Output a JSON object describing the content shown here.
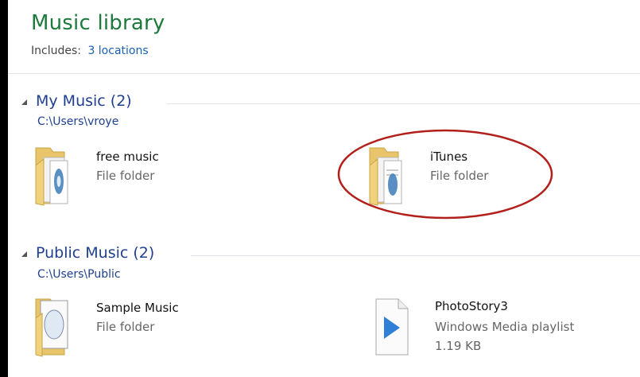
{
  "library": {
    "title": "Music library",
    "includes_label": "Includes:",
    "includes_link": "3 locations"
  },
  "groups": [
    {
      "title": "My Music (2)",
      "path": "C:\\Users\\vroye",
      "items": [
        {
          "name": "free music",
          "type": "File folder",
          "icon": "folder-icon"
        },
        {
          "name": "iTunes",
          "type": "File folder",
          "icon": "folder-icon",
          "highlighted": true
        }
      ]
    },
    {
      "title": "Public Music (2)",
      "path": "C:\\Users\\Public",
      "items": [
        {
          "name": "Sample Music",
          "type": "File folder",
          "icon": "folder-icon"
        },
        {
          "name": "PhotoStory3",
          "type": "Windows Media playlist",
          "size": "1.19 KB",
          "icon": "playlist-icon"
        }
      ]
    }
  ],
  "colors": {
    "title": "#1e7a3c",
    "group_title": "#1f3f8f",
    "link": "#1a5fb4",
    "annotation": "#b3201c"
  }
}
